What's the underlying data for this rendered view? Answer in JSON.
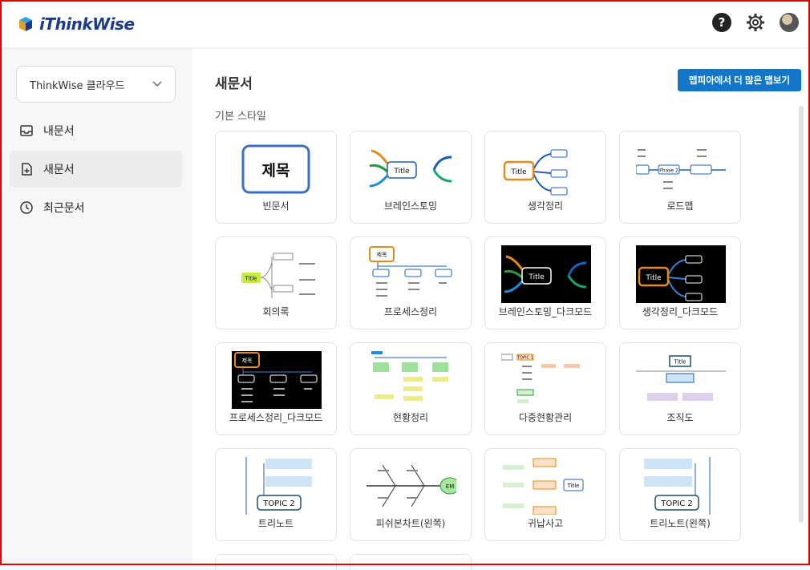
{
  "app": {
    "logo_text": "iThinkWise"
  },
  "sidebar": {
    "workspace_select": "ThinkWise 클라우드",
    "items": [
      {
        "label": "내문서",
        "icon": "inbox-icon"
      },
      {
        "label": "새문서",
        "icon": "new-document-icon"
      },
      {
        "label": "최근문서",
        "icon": "clock-icon"
      }
    ]
  },
  "main": {
    "title": "새문서",
    "more_button": "맵피아에서 더 많은 맵보기",
    "section_title": "기본 스타일",
    "templates": [
      {
        "label": "빈문서",
        "thumb_text": "제목"
      },
      {
        "label": "브레인스토밍",
        "thumb_text": "Title"
      },
      {
        "label": "생각정리",
        "thumb_text": "Title"
      },
      {
        "label": "로드맵",
        "thumb_text": "Phase 2"
      },
      {
        "label": "회의록",
        "thumb_text": "Title"
      },
      {
        "label": "프로세스정리",
        "thumb_text": "제목"
      },
      {
        "label": "브레인스토밍_다크모드",
        "thumb_text": "Title"
      },
      {
        "label": "생각정리_다크모드",
        "thumb_text": "Title"
      },
      {
        "label": "프로세스정리_다크모드",
        "thumb_text": "제목"
      },
      {
        "label": "현황정리",
        "thumb_text": ""
      },
      {
        "label": "다중현황관리",
        "thumb_text": "TOPIC 1"
      },
      {
        "label": "조직도",
        "thumb_text": "Title"
      },
      {
        "label": "트리노트",
        "thumb_text": "TOPIC 2"
      },
      {
        "label": "피쉬본차트(왼쪽)",
        "thumb_text": "EM"
      },
      {
        "label": "귀납사고",
        "thumb_text": "Title"
      },
      {
        "label": "트리노트(왼쪽)",
        "thumb_text": "TOPIC 2"
      }
    ]
  },
  "colors": {
    "accent": "#1277c8",
    "logo": "#1d3a8a",
    "frame": "#e00000"
  }
}
